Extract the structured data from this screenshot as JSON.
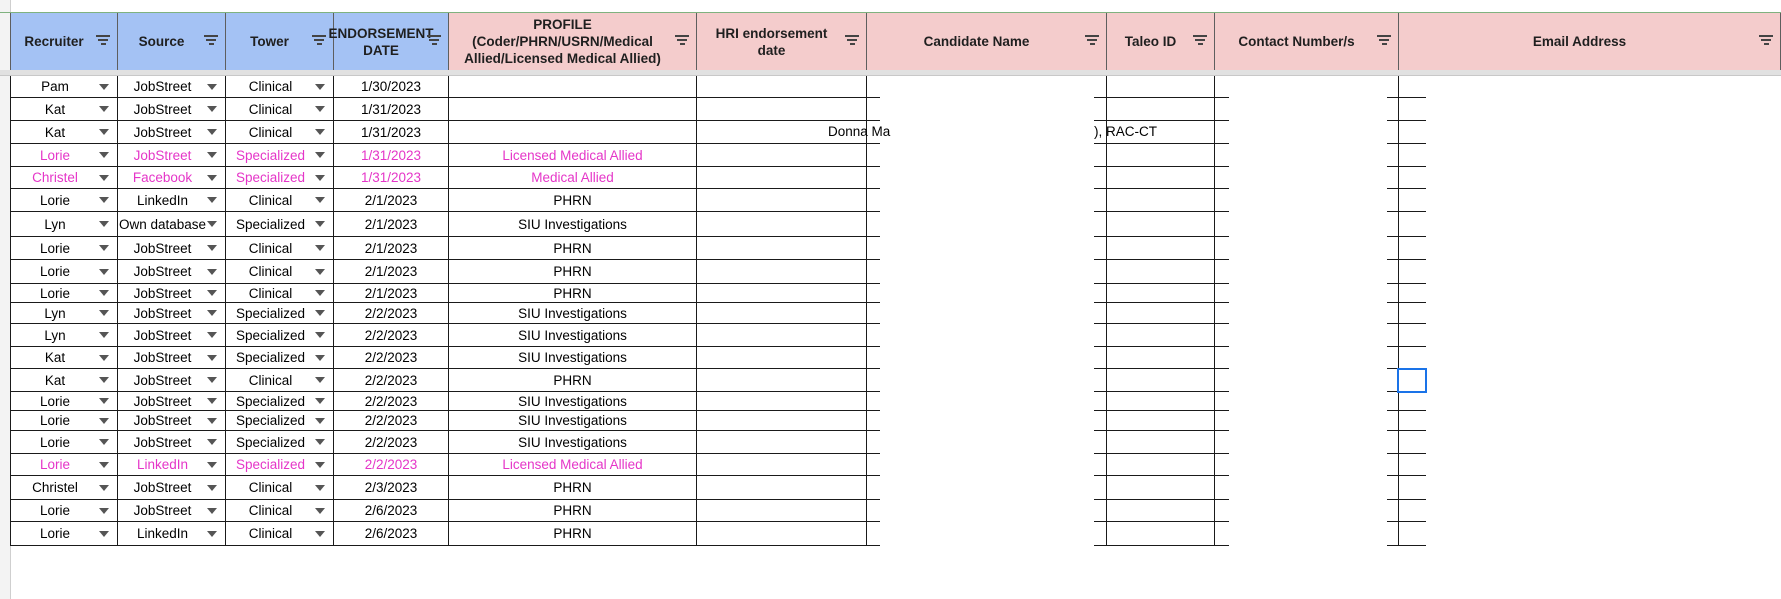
{
  "headers": [
    {
      "label": "Recruiter",
      "bg": "#a4c2f4"
    },
    {
      "label": "Source",
      "bg": "#a4c2f4"
    },
    {
      "label": "Tower",
      "bg": "#a4c2f4"
    },
    {
      "label": "ENDORSEMENT DATE",
      "bg": "#a4c2f4"
    },
    {
      "label": "PROFILE (Coder/PHRN/USRN/Medical Allied/Licensed Medical Allied)",
      "bg": "#f4cccc"
    },
    {
      "label": "HRI endorsement date",
      "bg": "#f4cccc"
    },
    {
      "label": "Candidate Name",
      "bg": "#f4cccc"
    },
    {
      "label": "Taleo ID",
      "bg": "#f4cccc"
    },
    {
      "label": "Contact Number/s",
      "bg": "#f4cccc"
    },
    {
      "label": "Email Address",
      "bg": "#f4cccc"
    }
  ],
  "colors": {
    "highlight_text": "#e535c8",
    "header_blue": "#a4c2f4",
    "header_pink": "#f4cccc",
    "selection": "#1a73e8"
  },
  "partial_texts": {
    "donna": "Donna Ma",
    "rac": "), RAC-CT"
  },
  "rows": [
    {
      "recruiter": "Pam",
      "source": "JobStreet",
      "tower": "Clinical",
      "date": "1/30/2023",
      "profile": "",
      "pink": false
    },
    {
      "recruiter": "Kat",
      "source": "JobStreet",
      "tower": "Clinical",
      "date": "1/31/2023",
      "profile": "",
      "pink": false
    },
    {
      "recruiter": "Kat",
      "source": "JobStreet",
      "tower": "Clinical",
      "date": "1/31/2023",
      "profile": "",
      "pink": false
    },
    {
      "recruiter": "Lorie",
      "source": "JobStreet",
      "tower": "Specialized",
      "date": "1/31/2023",
      "profile": "Licensed Medical Allied",
      "pink": true
    },
    {
      "recruiter": "Christel",
      "source": "Facebook",
      "tower": "Specialized",
      "date": "1/31/2023",
      "profile": "Medical Allied",
      "pink": true
    },
    {
      "recruiter": "Lorie",
      "source": "LinkedIn",
      "tower": "Clinical",
      "date": "2/1/2023",
      "profile": "PHRN",
      "pink": false
    },
    {
      "recruiter": "Lyn",
      "source": "Own database",
      "tower": "Specialized",
      "date": "2/1/2023",
      "profile": "SIU Investigations",
      "pink": false
    },
    {
      "recruiter": "Lorie",
      "source": "JobStreet",
      "tower": "Clinical",
      "date": "2/1/2023",
      "profile": "PHRN",
      "pink": false
    },
    {
      "recruiter": "Lorie",
      "source": "JobStreet",
      "tower": "Clinical",
      "date": "2/1/2023",
      "profile": "PHRN",
      "pink": false
    },
    {
      "recruiter": "Lorie",
      "source": "JobStreet",
      "tower": "Clinical",
      "date": "2/1/2023",
      "profile": "PHRN",
      "pink": false
    },
    {
      "recruiter": "Lyn",
      "source": "JobStreet",
      "tower": "Specialized",
      "date": "2/2/2023",
      "profile": "SIU Investigations",
      "pink": false
    },
    {
      "recruiter": "Lyn",
      "source": "JobStreet",
      "tower": "Specialized",
      "date": "2/2/2023",
      "profile": "SIU Investigations",
      "pink": false
    },
    {
      "recruiter": "Kat",
      "source": "JobStreet",
      "tower": "Specialized",
      "date": "2/2/2023",
      "profile": "SIU Investigations",
      "pink": false
    },
    {
      "recruiter": "Kat",
      "source": "JobStreet",
      "tower": "Clinical",
      "date": "2/2/2023",
      "profile": "PHRN",
      "pink": false
    },
    {
      "recruiter": "Lorie",
      "source": "JobStreet",
      "tower": "Specialized",
      "date": "2/2/2023",
      "profile": "SIU Investigations",
      "pink": false
    },
    {
      "recruiter": "Lorie",
      "source": "JobStreet",
      "tower": "Specialized",
      "date": "2/2/2023",
      "profile": "SIU Investigations",
      "pink": false
    },
    {
      "recruiter": "Lorie",
      "source": "JobStreet",
      "tower": "Specialized",
      "date": "2/2/2023",
      "profile": "SIU Investigations",
      "pink": false
    },
    {
      "recruiter": "Lorie",
      "source": "LinkedIn",
      "tower": "Specialized",
      "date": "2/2/2023",
      "profile": "Licensed Medical Allied",
      "pink": true
    },
    {
      "recruiter": "Christel",
      "source": "JobStreet",
      "tower": "Clinical",
      "date": "2/3/2023",
      "profile": "PHRN",
      "pink": false
    },
    {
      "recruiter": "Lorie",
      "source": "JobStreet",
      "tower": "Clinical",
      "date": "2/6/2023",
      "profile": "PHRN",
      "pink": false
    },
    {
      "recruiter": "Lorie",
      "source": "LinkedIn",
      "tower": "Clinical",
      "date": "2/6/2023",
      "profile": "PHRN",
      "pink": false
    }
  ]
}
